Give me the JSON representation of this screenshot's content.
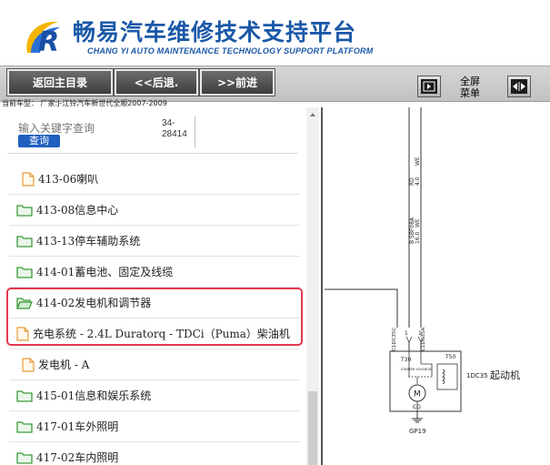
{
  "header": {
    "title": "畅易汽车维修技术支持平台",
    "subtitle": "CHANG YI AUTO MAINTENANCE TECHNOLOGY SUPPORT PLATFORM"
  },
  "toolbar": {
    "home_label": "返回主目录",
    "back_label": "<<后退.",
    "forward_label": ">>前进",
    "fullscreen_line1": "全屏",
    "fullscreen_line2": "菜单"
  },
  "model_line": "当前车型：  厂家:J-江铃汽车新世代全顺2007-2009",
  "search": {
    "placeholder": "输入关键字查询",
    "button_label": "查询",
    "code_line1": "34-",
    "code_line2": "28414"
  },
  "tree": [
    {
      "label": "413-06喇叭",
      "icon": "file"
    },
    {
      "label": "413-08信息中心",
      "icon": "folder"
    },
    {
      "label": "413-13停车辅助系统",
      "icon": "folder"
    },
    {
      "label": "414-01蓄电池、固定及线缆",
      "icon": "folder"
    },
    {
      "label": "414-02发电机和调节器",
      "icon": "folder-open"
    },
    {
      "label": "充电系统 - 2.4L Duratorq - TDCi（Puma）柴油机",
      "icon": "file"
    },
    {
      "label": "发电机 - A",
      "icon": "file"
    },
    {
      "label": "415-01信息和娱乐系统",
      "icon": "folder"
    },
    {
      "label": "417-01车外照明",
      "icon": "folder"
    },
    {
      "label": "417-02车内照明",
      "icon": "folder"
    }
  ],
  "diagram": {
    "wire1_color": "RD",
    "wire1_spec": "4.0",
    "wire1_code": "WE",
    "wire2_spec": "B SBF08A",
    "wire2_code": "16.0",
    "wire2_code2": "WE",
    "conn_left": "C1DC35C",
    "conn_right": "C1DC35A",
    "pin_left": "1",
    "pin_right": "1",
    "terminal_30": "T30",
    "terminal_50": "T50",
    "solenoid_label": "STARTER SOLENOID",
    "component_code": "1DC35",
    "component_name": "起动机",
    "motor_symbol": "M",
    "ground_terminal": "CG",
    "ground_code": "GP19"
  },
  "colors": {
    "brand_blue": "#1a58a8",
    "highlight_red": "#e5394f",
    "folder_green": "#3a9a3a",
    "file_orange": "#e89a3c"
  }
}
